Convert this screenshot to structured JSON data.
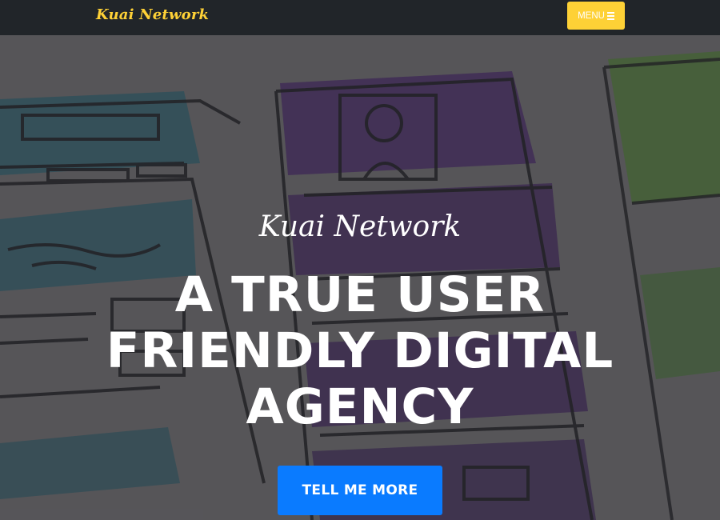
{
  "navbar": {
    "brand": "Kuai Network",
    "menu_label": "MENU",
    "menu_icon": "hamburger-icon"
  },
  "hero": {
    "lead_in": "Kuai Network",
    "heading": "A TRUE USER FRIENDLY DIGITAL AGENCY",
    "cta_label": "TELL ME MORE",
    "background": "wireframe-sketch-photo"
  },
  "colors": {
    "navbar_bg": "#212529",
    "brand": "#fed136",
    "menu_button": "#fed136",
    "cta_button": "#0a7bff"
  }
}
